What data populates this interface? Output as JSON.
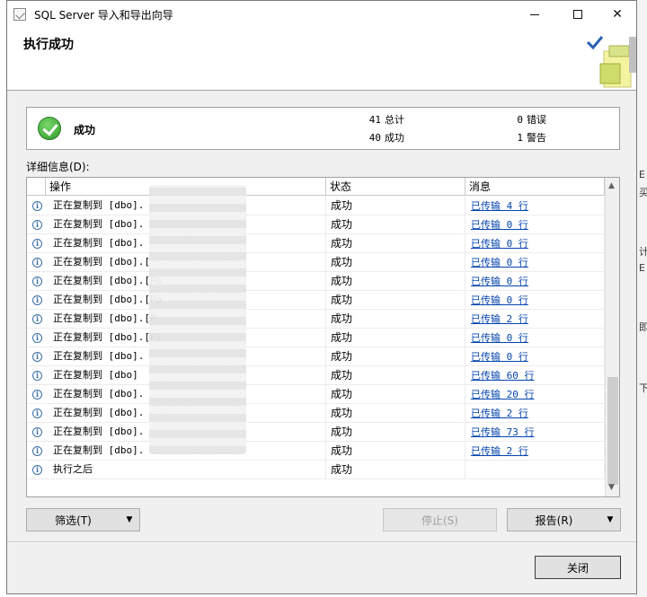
{
  "window": {
    "title": "SQL Server 导入和导出向导",
    "header_title": "执行成功"
  },
  "summary": {
    "status": "成功",
    "total_count": "41",
    "total_label": "总计",
    "success_count": "40",
    "success_label": "成功",
    "error_count": "0",
    "error_label": "错误",
    "warning_count": "1",
    "warning_label": "警告"
  },
  "details": {
    "label": "详细信息(D):",
    "columns": [
      "操作",
      "状态",
      "消息"
    ],
    "rows": [
      {
        "op": "正在复制到 [dbo].",
        "status": "成功",
        "msg": "已传输 4 行"
      },
      {
        "op": "正在复制到 [dbo].",
        "status": "成功",
        "msg": "已传输 0 行"
      },
      {
        "op": "正在复制到 [dbo].",
        "status": "成功",
        "msg": "已传输 0 行"
      },
      {
        "op": "正在复制到 [dbo].[",
        "status": "成功",
        "msg": "已传输 0 行"
      },
      {
        "op": "正在复制到 [dbo].[Pa",
        "status": "成功",
        "msg": "已传输 0 行"
      },
      {
        "op": "正在复制到 [dbo].[Pa",
        "status": "成功",
        "msg": "已传输 0 行"
      },
      {
        "op": "正在复制到 [dbo].[P",
        "status": "成功",
        "msg": "已传输 2 行"
      },
      {
        "op": "正在复制到 [dbo].[Pl",
        "status": "成功",
        "msg": "已传输 0 行"
      },
      {
        "op": "正在复制到 [dbo].",
        "status": "成功",
        "msg": "已传输 0 行"
      },
      {
        "op": "正在复制到 [dbo]",
        "status": "成功",
        "msg": "已传输 60 行"
      },
      {
        "op": "正在复制到 [dbo].",
        "status": "成功",
        "msg": "已传输 20 行"
      },
      {
        "op": "正在复制到 [dbo].",
        "status": "成功",
        "msg": "已传输 2 行"
      },
      {
        "op": "正在复制到 [dbo].",
        "status": "成功",
        "msg": "已传输 73 行"
      },
      {
        "op": "正在复制到 [dbo].",
        "status": "成功",
        "msg": "已传输 2 行"
      },
      {
        "op": "执行之后",
        "status": "成功",
        "msg": ""
      }
    ]
  },
  "buttons": {
    "filter": "筛选(T)",
    "stop": "停止(S)",
    "report": "报告(R)",
    "close": "关闭"
  },
  "colors": {
    "link": "#0645ad",
    "success": "#2d9a2a"
  }
}
